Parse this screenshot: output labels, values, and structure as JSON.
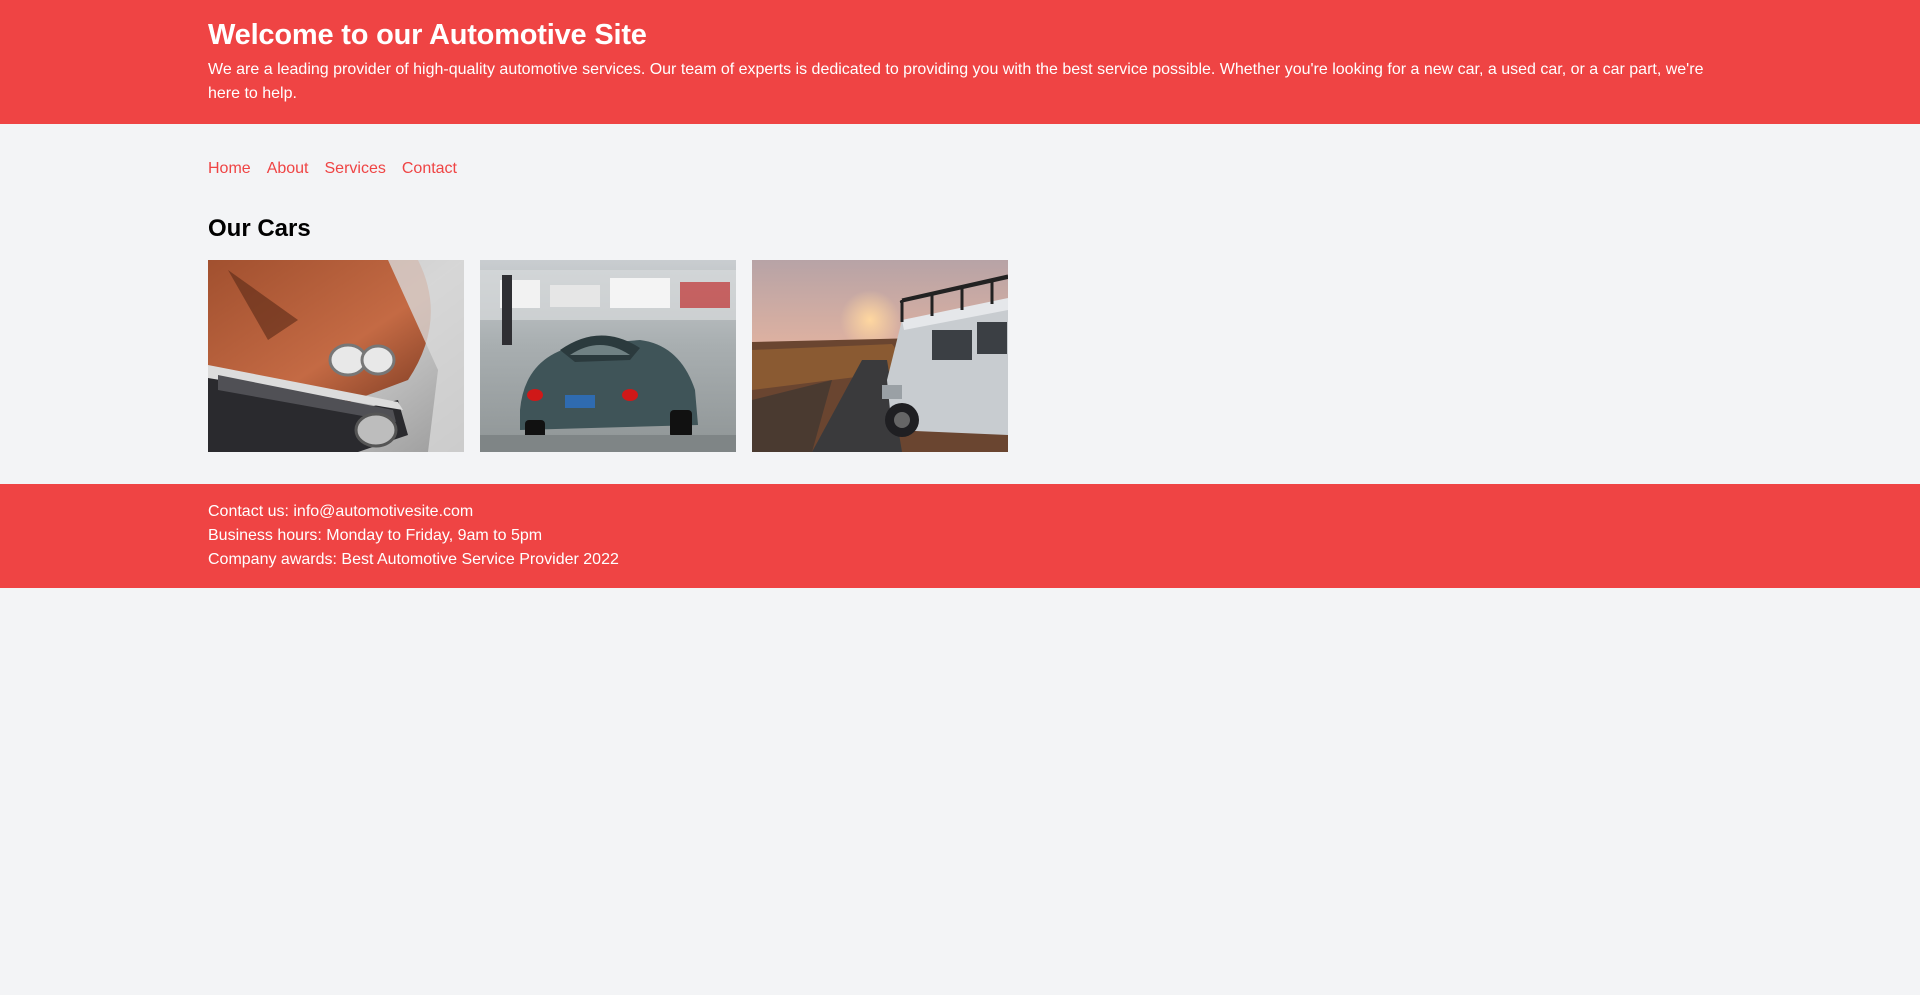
{
  "colors": {
    "brand": "#ef4444",
    "background": "#f3f4f6",
    "text_on_brand": "#ffffff"
  },
  "header": {
    "title": "Welcome to our Automotive Site",
    "intro": "We are a leading provider of high-quality automotive services. Our team of experts is dedicated to providing you with the best service possible. Whether you're looking for a new car, a used car, or a car part, we're here to help."
  },
  "nav": {
    "items": [
      {
        "label": "Home"
      },
      {
        "label": "About"
      },
      {
        "label": "Services"
      },
      {
        "label": "Contact"
      }
    ]
  },
  "cars": {
    "title": "Our Cars",
    "images": [
      {
        "name": "rusty-classic-car-photo"
      },
      {
        "name": "vintage-sports-car-rear-photo"
      },
      {
        "name": "white-offroad-suv-sunset-photo"
      }
    ]
  },
  "footer": {
    "contact": "Contact us: info@automotivesite.com",
    "hours": "Business hours: Monday to Friday, 9am to 5pm",
    "awards": "Company awards: Best Automotive Service Provider 2022"
  }
}
